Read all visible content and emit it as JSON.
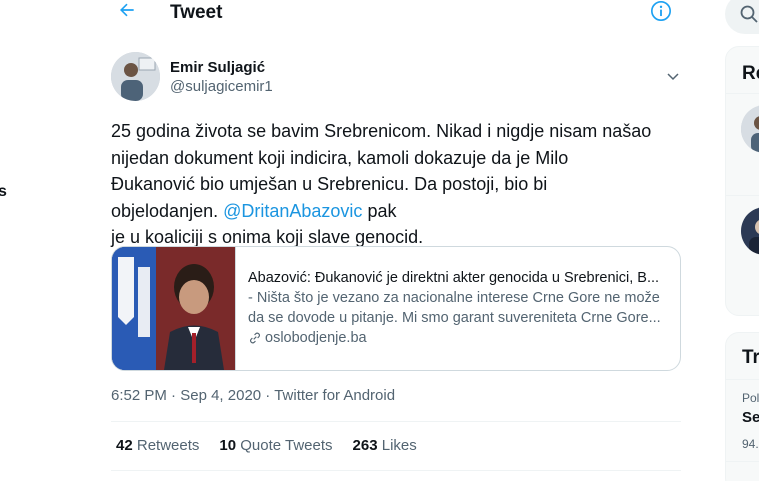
{
  "edge_fragment": "s",
  "header": {
    "title": "Tweet"
  },
  "author": {
    "name": "Emir Suljagić",
    "handle": "@suljagicemir1"
  },
  "tweet": {
    "line1": "25 godina života se bavim Srebrenicom. Nikad i nigdje nisam našao",
    "line2": "nijedan dokument koji indicira, kamoli dokazuje da je Milo",
    "line3": "Đukanović bio umješan u Srebrenicu. Da postoji, bio bi",
    "line4_pre": "objelodanjen. ",
    "mention": "@DritanAbazovic",
    "line4_post": " pak",
    "line5": "je u koaliciji s onima koji slave genocid."
  },
  "card": {
    "title": "Abazović: Đukanović je direktni akter genocida u Srebrenici, B...",
    "description": "- Ništa što je vezano za nacionalne interese Crne Gore ne može da se dovode u pitanje. Mi smo garant suvereniteta Crne Gore...",
    "domain": "oslobodjenje.ba"
  },
  "meta": {
    "time": "6:52 PM",
    "separator": " · ",
    "date": "Sep 4, 2020",
    "source": "Twitter for Android"
  },
  "stats": {
    "retweets_count": "42",
    "retweets_label": " Retweets",
    "quotes_count": "10",
    "quotes_label": " Quote Tweets",
    "likes_count": "263",
    "likes_label": " Likes"
  },
  "sidebar": {
    "panel1_heading": "Re",
    "panel2_heading": "Tr",
    "trend_category": "Pol",
    "trend_name": "Se",
    "trend_count": "94."
  },
  "colors": {
    "accent": "#1da1f2",
    "link": "#1b95e0",
    "text": "#0f1419",
    "secondary": "#536471",
    "border": "#cfd9de"
  },
  "icons": [
    "back-arrow-icon",
    "info-icon",
    "chevron-down-icon",
    "link-icon",
    "search-icon"
  ]
}
